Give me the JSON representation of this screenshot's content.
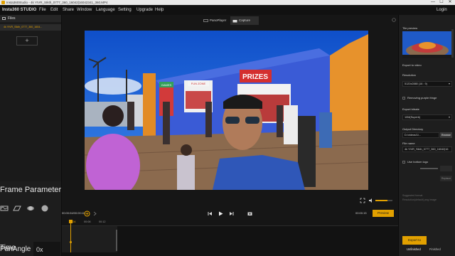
{
  "window": {
    "title": "Insta360Studio - 4k YIVR_SIkth_0777_360_16042|16042341_360.MP4",
    "controls": [
      "—",
      "☐",
      "✕"
    ]
  },
  "menu": {
    "items": [
      "Insta360 STUDIO",
      "File",
      "Edit",
      "Share",
      "Window",
      "Language",
      "Setting",
      "Upgrade",
      "Help"
    ],
    "login": "Login"
  },
  "files_panel": {
    "header": "Files",
    "item": "4k YIVR_SIkth_0777_360_1604...",
    "add_label": "+"
  },
  "modes": {
    "panoplayer": "PanoPlayer",
    "capture": "Capture"
  },
  "viewport": {
    "sign_prizes": "PRIZES",
    "sign_left": "GAMES",
    "sign_mid": "FUN ZONE"
  },
  "playback": {
    "current_time": "00:00:04/00:00:11",
    "end_time": "00:00:15",
    "preview_label": "Preview",
    "speaker_level": 0.7
  },
  "timeline": {
    "ticks": [
      "00:04",
      "00:08",
      "00:12"
    ],
    "playhead_fraction": 0.16
  },
  "frame_parameters": {
    "title": "Frame Parameter",
    "time_label": "Time",
    "time_value": "0",
    "pan_angle_label": "PanAngle",
    "pan_angle_value": "0x",
    "icons": [
      "rectangle-icon",
      "plane-icon",
      "planet-icon",
      "sphere-icon"
    ]
  },
  "right_panel": {
    "tile_preview_label": "Tile preview",
    "export_to_video": "Export to video",
    "resolution_label": "Resolution",
    "resolution_value": "5120x2880 (16 : 9)",
    "removing_purple_fringe": "Removing purple fringe",
    "export_bitrate_label": "Export bitrate",
    "export_bitrate_value": "10M(Superb)",
    "output_directory_label": "Output Directory",
    "output_directory_value": "D:/videos/1/...",
    "browse_label": "Browse",
    "file_name_label": "File name",
    "file_name_value": "4k YIVR_SIkth_0777_360_16042|16",
    "use_bottom_logo": "Use bottom logo",
    "replace_label": "Replace",
    "suggested_text_1": "Suggested format",
    "suggested_text_2": "Resolution(default) png image",
    "export_button": "Export to",
    "unfinished_label": "Unfinished",
    "finished_label": "Finished"
  },
  "colors": {
    "accent": "#e2a100",
    "bg": "#1b1b1b",
    "sky": "#1a5fd0",
    "building": "#3a5bd6"
  }
}
